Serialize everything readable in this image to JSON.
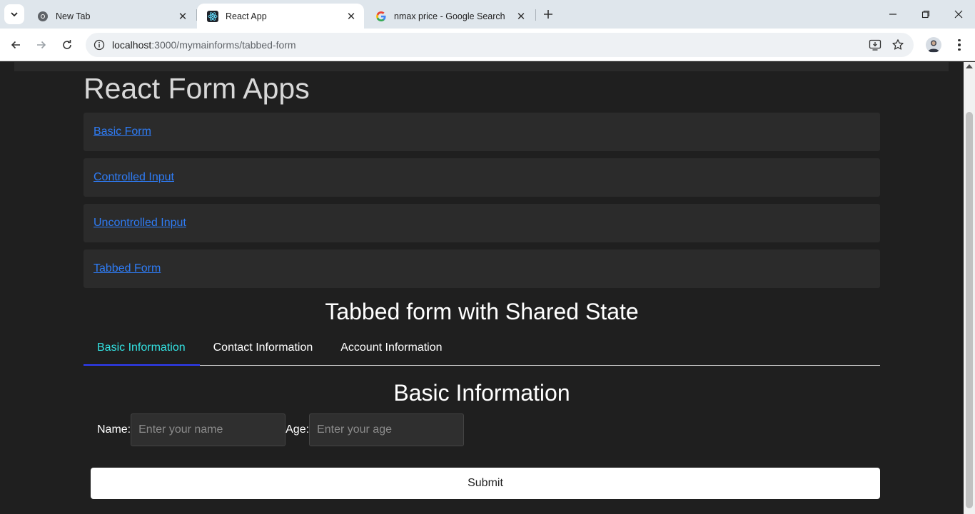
{
  "browser": {
    "tabs": [
      {
        "title": "New Tab",
        "icon": "chrome-icon",
        "active": false
      },
      {
        "title": "React App",
        "icon": "react-icon",
        "active": true
      },
      {
        "title": "nmax price - Google Search",
        "icon": "google-icon",
        "active": false
      }
    ],
    "url_host": "localhost",
    "url_path": ":3000/mymainforms/tabbed-form"
  },
  "page": {
    "title": "React Form Apps",
    "nav_links": [
      "Basic Form",
      "Controlled Input",
      "Uncontrolled Input",
      "Tabbed Form"
    ],
    "form_heading": "Tabbed form with Shared State",
    "form_tabs": [
      "Basic Information",
      "Contact Information",
      "Account Information"
    ],
    "active_tab": "Basic Information",
    "section_heading": "Basic Information",
    "name_label": "Name:",
    "name_placeholder": "Enter your name",
    "age_label": "Age:",
    "age_placeholder": "Enter your age",
    "submit_label": "Submit"
  },
  "colors": {
    "page_bg": "#1f1f1f",
    "link": "#2e7cf6",
    "active_tab_text": "#33e3e3",
    "active_tab_underline": "#2f3dff"
  }
}
